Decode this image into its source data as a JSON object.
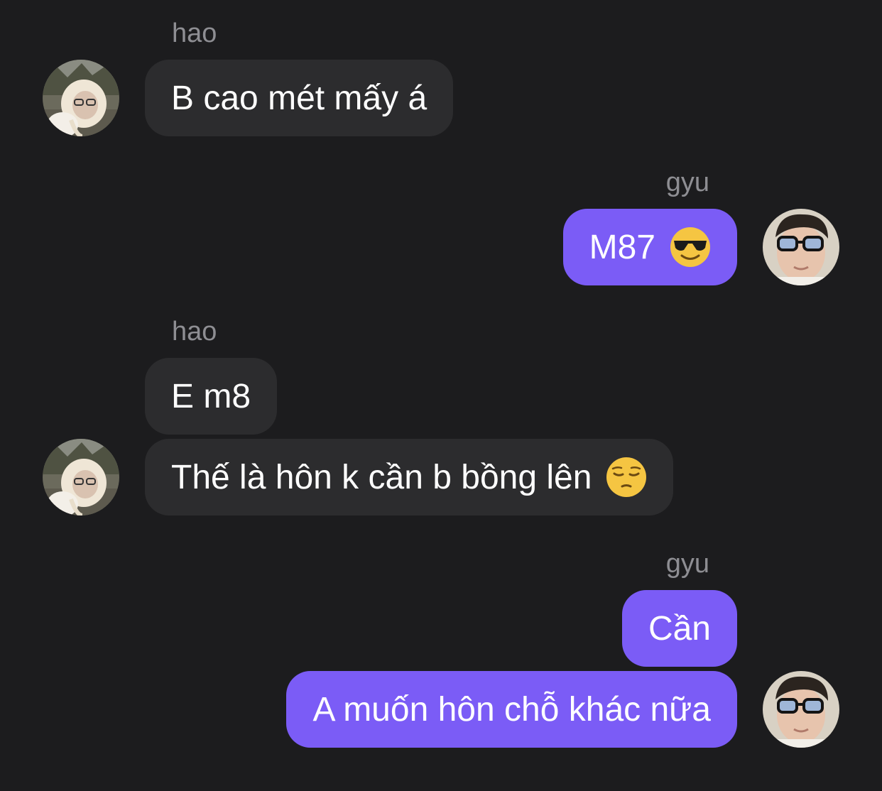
{
  "conversation": {
    "messages": [
      {
        "sender": "hao",
        "text": "B cao mét mấy á"
      },
      {
        "sender": "gyu",
        "text": "M87",
        "emoji_icon": "smiling-face-with-sunglasses-icon"
      },
      {
        "sender": "hao",
        "text": "E m8"
      },
      {
        "sender": "hao",
        "text": "Thế là hôn k cần b bồng lên",
        "emoji_icon": "pensive-face-icon"
      },
      {
        "sender": "gyu",
        "text": "Cần"
      },
      {
        "sender": "gyu",
        "text": "A muốn hôn chỗ khác nữa"
      }
    ]
  },
  "colors": {
    "background": "#1c1c1e",
    "incoming_bubble": "#2c2c2e",
    "outgoing_bubble": "#7b5cf6",
    "sender_name": "#8e8e93"
  }
}
